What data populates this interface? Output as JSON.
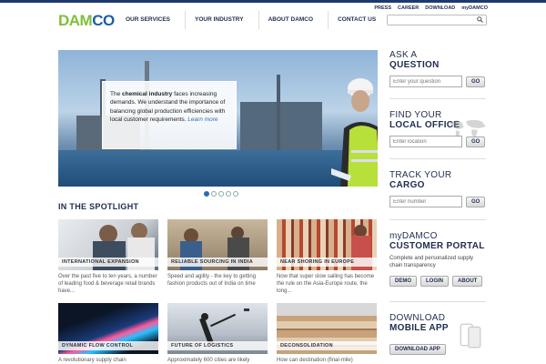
{
  "brand": {
    "logo_part1": "DAM",
    "logo_part2": "CO",
    "colors": {
      "green": "#7fbf3a",
      "blue": "#1d5ea8",
      "navy": "#1f2d4d"
    }
  },
  "utility": [
    "PRESS",
    "CAREER",
    "DOWNLOAD",
    "myDAMCO"
  ],
  "nav": [
    "OUR SERVICES",
    "YOUR INDUSTRY",
    "ABOUT DAMCO",
    "CONTACT US"
  ],
  "search": {
    "placeholder": "",
    "icon": "search-icon"
  },
  "hero": {
    "text_before": "The ",
    "text_bold": "chemical industry",
    "text_after": " faces increasing demands. We understand the importance of balancing global production efficiencies with local customer requirements. ",
    "link": "Learn more",
    "slides": 5,
    "active_slide": 1
  },
  "spotlight": {
    "title": "IN THE SPOTLIGHT",
    "tiles": [
      {
        "caption": "INTERNATIONAL EXPANSION",
        "desc": "Over the past five to ten years, a number of leading food & beverage retail brands have..."
      },
      {
        "caption": "RELIABLE SOURCING IN INDIA",
        "desc": "Speed and agility - the key to getting fashion products out of India on time"
      },
      {
        "caption": "NEAR SHORING IN EUROPE",
        "desc": "Now that super slow sailing has become the rule on the Asia-Europe route, the long..."
      },
      {
        "caption": "DYNAMIC FLOW CONTROL",
        "desc": "A revolutionary supply chain"
      },
      {
        "caption": "FUTURE OF LOGISTICS",
        "desc": "Approximately 600 cities are likely"
      },
      {
        "caption": "DECONSOLIDATION",
        "desc": "How can destination (final-mile)"
      }
    ]
  },
  "sidebar": {
    "ask": {
      "line1": "ASK A",
      "line2": "QUESTION",
      "placeholder": "Enter your question",
      "button": "GO"
    },
    "office": {
      "line1": "FIND YOUR",
      "line2": "LOCAL OFFICE",
      "placeholder": "Enter location",
      "button": "GO"
    },
    "cargo": {
      "line1": "TRACK YOUR",
      "line2": "CARGO",
      "placeholder": "Enter number",
      "button": "GO"
    },
    "portal": {
      "line1": "myDAMCO",
      "line2": "CUSTOMER PORTAL",
      "text": "Complete and personalized supply chain transparency",
      "buttons": [
        "DEMO",
        "LOGIN",
        "ABOUT"
      ]
    },
    "mobile": {
      "line1": "DOWNLOAD",
      "line2": "MOBILE APP",
      "button": "DOWNLOAD APP"
    }
  }
}
